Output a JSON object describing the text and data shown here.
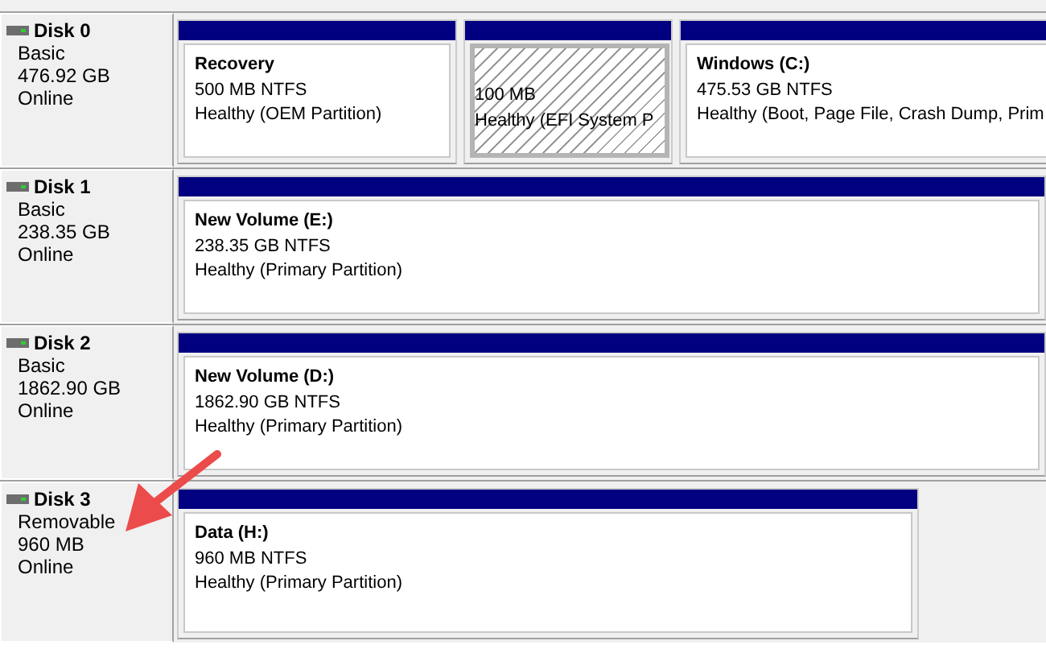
{
  "disks": [
    {
      "name": "Disk 0",
      "type": "Basic",
      "size": "476.92 GB",
      "status": "Online",
      "partitions": [
        {
          "title": "Recovery",
          "size": "500 MB NTFS",
          "health": "Healthy (OEM Partition)",
          "selected": false
        },
        {
          "size": "100 MB",
          "health": "Healthy (EFI System P",
          "selected": true
        },
        {
          "title": "Windows  (C:)",
          "size": "475.53 GB NTFS",
          "health": "Healthy (Boot, Page File, Crash Dump, Prim",
          "selected": false
        }
      ]
    },
    {
      "name": "Disk 1",
      "type": "Basic",
      "size": "238.35 GB",
      "status": "Online",
      "partitions": [
        {
          "title": "New Volume  (E:)",
          "size": "238.35 GB NTFS",
          "health": "Healthy (Primary Partition)",
          "selected": false
        }
      ]
    },
    {
      "name": "Disk 2",
      "type": "Basic",
      "size": "1862.90 GB",
      "status": "Online",
      "partitions": [
        {
          "title": "New Volume  (D:)",
          "size": "1862.90 GB NTFS",
          "health": "Healthy (Primary Partition)",
          "selected": false
        }
      ]
    },
    {
      "name": "Disk 3",
      "type": "Removable",
      "size": "960 MB",
      "status": "Online",
      "partitions": [
        {
          "title": "Data  (H:)",
          "size": "960 MB NTFS",
          "health": "Healthy (Primary Partition)",
          "selected": false
        }
      ]
    }
  ]
}
